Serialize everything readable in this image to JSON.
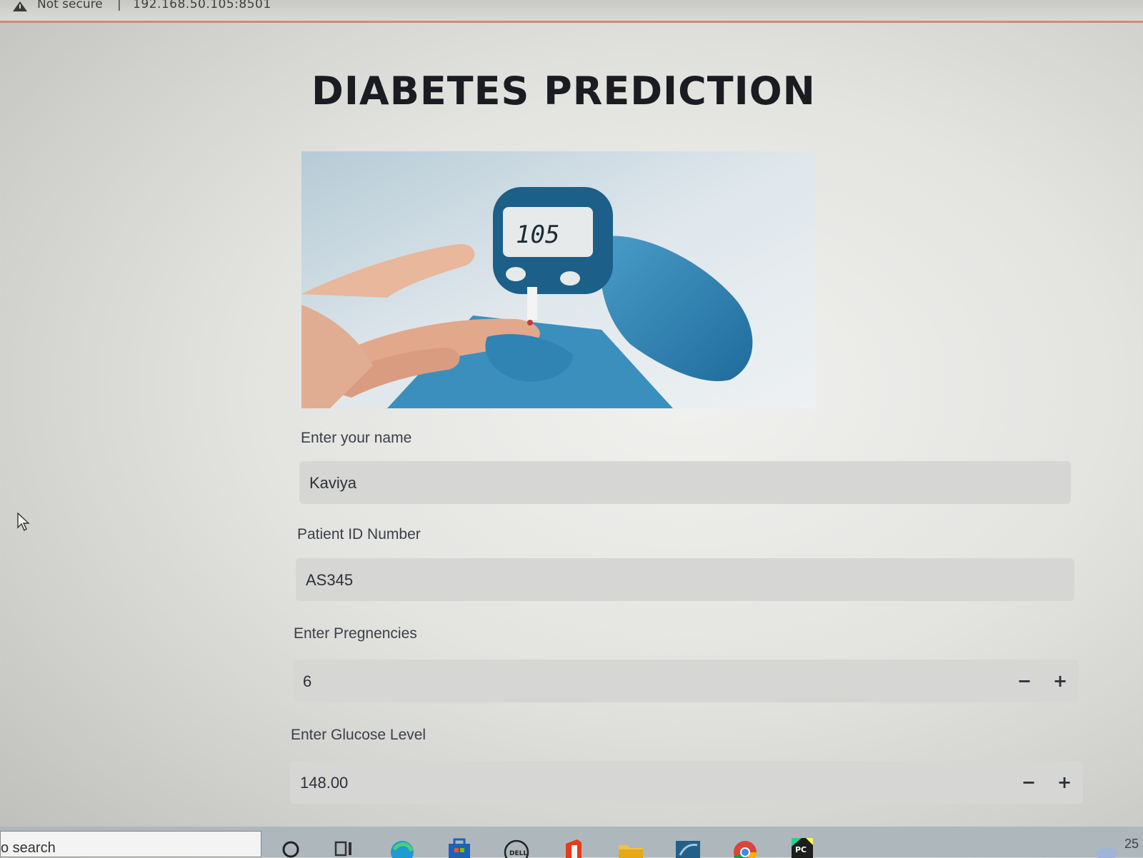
{
  "browser": {
    "security_label": "Not secure",
    "separator": "|",
    "url": "192.168.50.105:8501"
  },
  "page": {
    "title": "DIABETES PREDICTION",
    "meter_reading": "105"
  },
  "form": {
    "name": {
      "label": "Enter your name",
      "value": "Kaviya"
    },
    "patient_id": {
      "label": "Patient ID Number",
      "value": "AS345"
    },
    "pregnancies": {
      "label": "Enter Pregnencies",
      "value": "6",
      "decrement": "−",
      "increment": "+"
    },
    "glucose": {
      "label": "Enter Glucose Level",
      "value": "148.00",
      "decrement": "−",
      "increment": "+"
    }
  },
  "taskbar": {
    "search_placeholder": "o search",
    "clock_fragment": "25",
    "icons": [
      "search-icon",
      "task-view-icon",
      "edge-icon",
      "store-icon",
      "dell-icon",
      "office-icon",
      "file-explorer-icon",
      "mysql-workbench-icon",
      "chrome-icon",
      "pycharm-icon",
      "weather-icon"
    ]
  },
  "colors": {
    "title": "#1a1c22",
    "field_background": "#d6d6d4",
    "address_bar_accent": "#d08a78",
    "glove_blue": "#2f84b4"
  }
}
